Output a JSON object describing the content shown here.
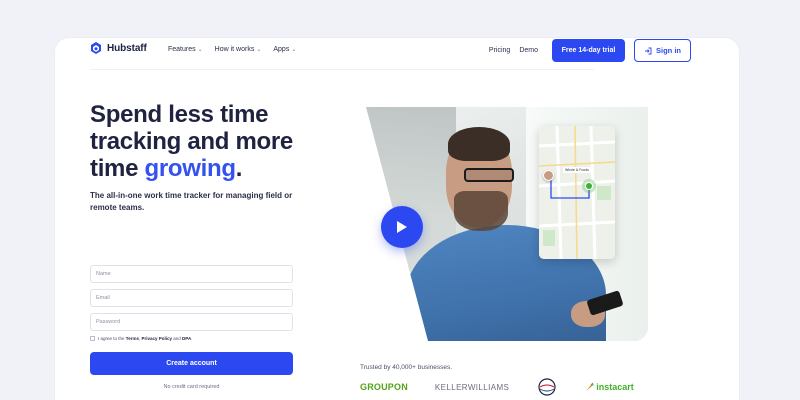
{
  "brand": {
    "name": "Hubstaff",
    "accent": "#2c49f1",
    "highlight": "#3452f0",
    "icon": "hubstaff-logo-icon"
  },
  "nav": {
    "items": [
      {
        "label": "Features"
      },
      {
        "label": "How it works"
      },
      {
        "label": "Apps"
      }
    ],
    "pricing_label": "Pricing",
    "demo_label": "Demo",
    "trial_label": "Free 14-day trial",
    "signin_label": "Sign in"
  },
  "hero": {
    "headline_start": "Spend less time tracking and more time ",
    "headline_highlight": "growing",
    "headline_end": ".",
    "subhead": "The all-in-one work time tracker for managing field or remote teams."
  },
  "form": {
    "name_placeholder": "Name",
    "email_placeholder": "Email",
    "password_placeholder": "Password",
    "terms_prefix": "I agree to the ",
    "terms_link": "Terms",
    "terms_sep": ", ",
    "privacy_link": "Privacy Policy",
    "and_text": " and ",
    "dpa_link": "DPA",
    "terms_suffix": ".",
    "submit_label": "Create account",
    "note": "No credit card required"
  },
  "map_card": {
    "place_label": "Whole & Foods"
  },
  "trust": {
    "label": "Trusted by 40,000+ businesses.",
    "logos": [
      "GROUPON",
      "KELLERWILLIAMS",
      "CLIPPERS",
      "instacart"
    ]
  }
}
